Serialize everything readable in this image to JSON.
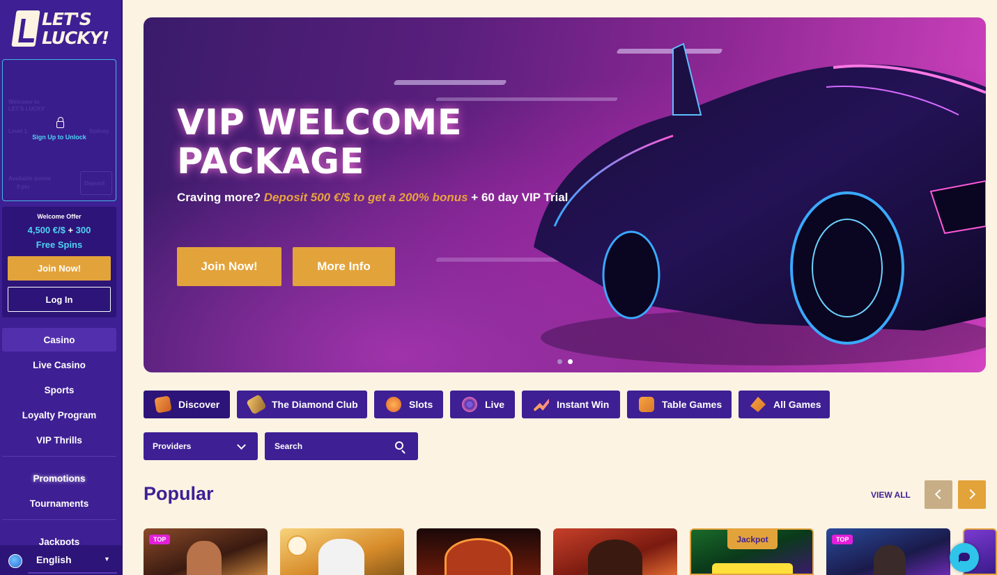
{
  "brand": {
    "logo_text_line1": "LET'S",
    "logo_text_line2": "LUCKY!"
  },
  "loyalty": {
    "faded_welcome": "Welcome to",
    "faded_brand": "LET'S LUCKY",
    "faded_level": "Level 1",
    "faded_city": "Sydney",
    "faded_points_label": "Available points",
    "faded_points": "0 pts",
    "faded_button": "Deposit",
    "unlock_text": "Sign Up to Unlock"
  },
  "welcome": {
    "label": "Welcome Offer",
    "amount": "4,500 €/$",
    "plus": " + ",
    "spins_count": "300",
    "spins_label": "Free Spins",
    "join_label": "Join Now!",
    "login_label": "Log In"
  },
  "nav": {
    "items": [
      {
        "label": "Casino"
      },
      {
        "label": "Live Casino"
      },
      {
        "label": "Sports"
      },
      {
        "label": "Loyalty Program"
      },
      {
        "label": "VIP Thrills"
      },
      {
        "label": "Promotions"
      },
      {
        "label": "Tournaments"
      },
      {
        "label": "Jackpots"
      }
    ]
  },
  "language": {
    "label": "English"
  },
  "hero": {
    "title_line1": "VIP WELCOME",
    "title_line2": "PACKAGE",
    "sub_prefix": "Craving more? ",
    "sub_highlight": "Deposit 500 €/$ to get a 200% bonus",
    "sub_suffix": " + 60 day VIP Trial",
    "btn_join": "Join Now!",
    "btn_info": "More Info",
    "slides_total": 2,
    "slide_active": 2
  },
  "categories": [
    {
      "label": "Discover",
      "icon": "discover-icon"
    },
    {
      "label": "The Diamond Club",
      "icon": "diamond-icon"
    },
    {
      "label": "Slots",
      "icon": "slots-icon"
    },
    {
      "label": "Live",
      "icon": "live-icon"
    },
    {
      "label": "Instant Win",
      "icon": "instant-win-icon"
    },
    {
      "label": "Table Games",
      "icon": "table-games-icon"
    },
    {
      "label": "All Games",
      "icon": "all-games-icon"
    }
  ],
  "filters": {
    "providers_label": "Providers",
    "search_placeholder": "Search"
  },
  "popular": {
    "title": "Popular",
    "view_all": "VIEW ALL",
    "badges": {
      "top": "TOP",
      "jackpot": "Jackpot"
    }
  },
  "colors": {
    "primary": "#3e1f94",
    "accent": "#e3a33b",
    "cyan": "#4fd2f5",
    "background": "#fdf3e3"
  }
}
